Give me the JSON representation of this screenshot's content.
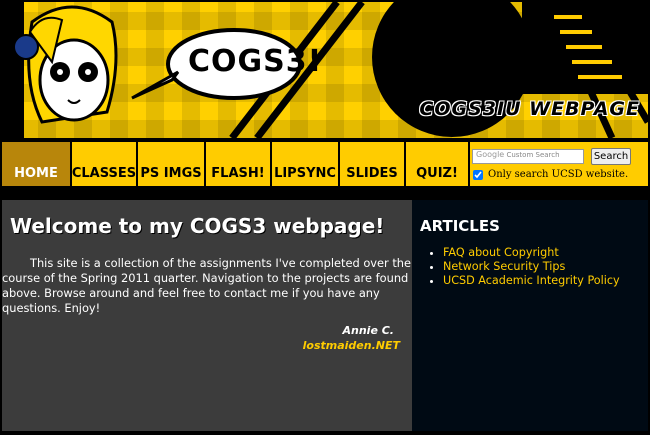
{
  "banner": {
    "bubble_text": "COGS3!",
    "title": "COGS3IU WEBPAGE"
  },
  "nav": {
    "items": [
      {
        "label": "HOME",
        "active": true
      },
      {
        "label": "CLASSES"
      },
      {
        "label": "PS IMGS"
      },
      {
        "label": "FLASH!"
      },
      {
        "label": "LIPSYNC"
      },
      {
        "label": "SLIDES"
      },
      {
        "label": "QUIZ!"
      }
    ]
  },
  "search": {
    "placeholder": "Custom Search",
    "google_label": "Google",
    "button_label": "Search",
    "checkbox_label": "Only search UCSD website.",
    "checked": true
  },
  "main": {
    "heading": "Welcome to my COGS3 webpage!",
    "intro": "This site is a collection of the assignments I've completed over the course of the Spring 2011 quarter. Navigation to the projects are found above. Browse around and feel free to contact me if you have any questions. Enjoy!",
    "author": "Annie C.",
    "site": "lostmaiden.NET"
  },
  "sidebar": {
    "title": "ARTICLES",
    "links": [
      "FAQ about Copyright",
      "Network Security Tips",
      "UCSD Academic Integrity Policy"
    ]
  },
  "colors": {
    "accent": "#ffcc00",
    "main_bg": "#3c3c3c",
    "sidebar_bg": "#000a14",
    "active_nav": "#b8860b"
  }
}
